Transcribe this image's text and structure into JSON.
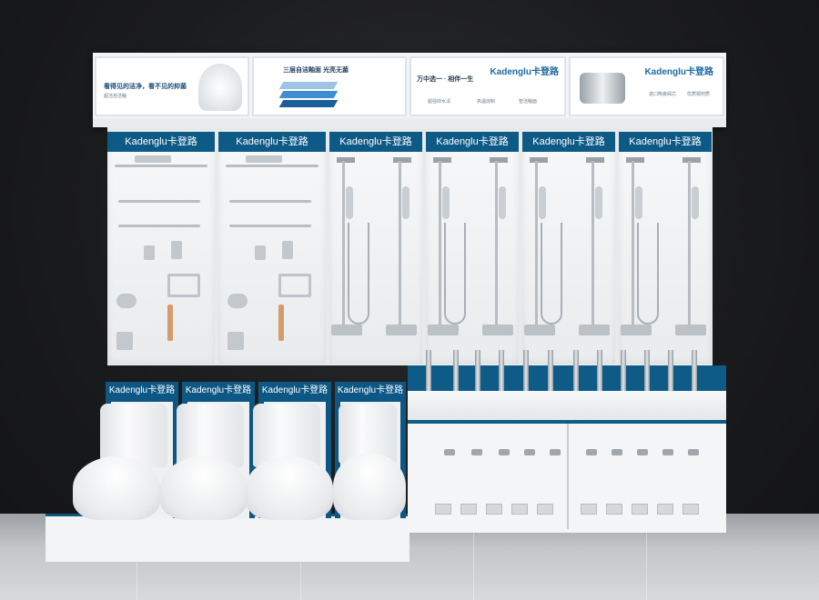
{
  "brand": {
    "name": "Kadenglu卡登路",
    "accent": "#0e5a86"
  },
  "header_banners": [
    {
      "title": "看得见的洁净，看不见的抑菌",
      "subtitle": "超洁自洁釉"
    },
    {
      "title": "三层自洁釉面  光亮无菌",
      "subtitle": ""
    },
    {
      "title": "万中选一 · 相伴一生",
      "brand": "Kadenglu卡登路",
      "features": [
        "超强抑水渍",
        "高温烧制",
        "智洁釉面"
      ]
    },
    {
      "brand": "Kadenglu卡登路",
      "features": [
        "进口陶瓷阀芯",
        "优质铜材质"
      ]
    }
  ],
  "wall_panels": [
    {
      "label": "Kadenglu卡登路",
      "kind": "accessories"
    },
    {
      "label": "Kadenglu卡登路",
      "kind": "accessories"
    },
    {
      "label": "Kadenglu卡登路",
      "kind": "shower"
    },
    {
      "label": "Kadenglu卡登路",
      "kind": "shower"
    },
    {
      "label": "Kadenglu卡登路",
      "kind": "shower"
    },
    {
      "label": "Kadenglu卡登路",
      "kind": "shower"
    }
  ],
  "toilet_bays": [
    {
      "label": "Kadenglu卡登路"
    },
    {
      "label": "Kadenglu卡登路"
    },
    {
      "label": "Kadenglu卡登路"
    },
    {
      "label": "Kadenglu卡登路"
    }
  ],
  "icons": [
    "towel-rack-icon",
    "shower-icon",
    "toilet-icon",
    "faucet-icon"
  ]
}
